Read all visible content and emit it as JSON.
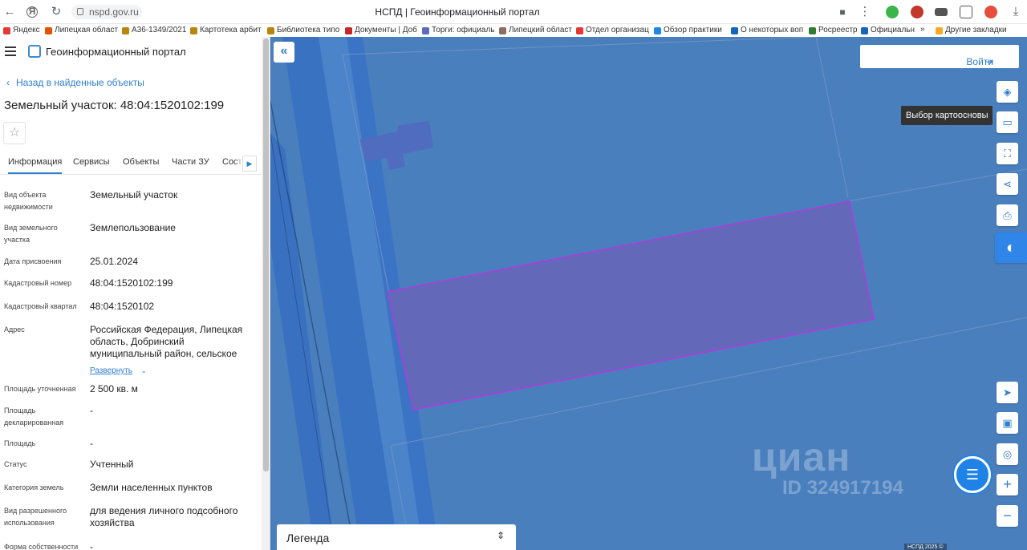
{
  "browser": {
    "url": "nspd.gov.ru",
    "tab_title": "НСПД | Геоинформационный портал",
    "bookmarks": [
      "Яндекс",
      "Липецкая област",
      "А36-1349/2021",
      "Картотека арбит",
      "Библиотека типо",
      "Документы | Доб",
      "Торги: официаль",
      "Липецкий област",
      "Отдел организац",
      "Обзор практики",
      "О некоторых воп",
      "Росреестр",
      "Официальн",
      "»",
      "Другие закладки"
    ],
    "colors": {
      "accent": "#2f7fd1",
      "map_bg": "#4a7fbe",
      "parcel_stroke": "#b03adf"
    }
  },
  "panel": {
    "portal_title": "Геоинформационный портал",
    "back_link": "Назад в найденные объекты",
    "object_title": "Земельный участок: 48:04:1520102:199",
    "tabs": [
      "Информация",
      "Сервисы",
      "Объекты",
      "Части ЗУ",
      "Соста"
    ],
    "rows": [
      {
        "label": "Вид объекта недвижимости",
        "value": "Земельный участок"
      },
      {
        "label": "Вид земельного участка",
        "value": "Землепользование"
      },
      {
        "label": "Дата присвоения",
        "value": "25.01.2024"
      },
      {
        "label": "Кадастровый номер",
        "value": "48:04:1520102:199"
      },
      {
        "label": "Кадастровый квартал",
        "value": "48:04:1520102"
      },
      {
        "label": "Адрес",
        "value": "Российская Федерация, Липецкая область, Добринский муниципальный район, сельское"
      },
      {
        "label": "Площадь уточненная",
        "value": "2 500 кв. м"
      },
      {
        "label": "Площадь декларированная",
        "value": "-"
      },
      {
        "label": "Площадь",
        "value": "-"
      },
      {
        "label": "Статус",
        "value": "Учтенный"
      },
      {
        "label": "Категория земель",
        "value": "Земли населенных пунктов"
      },
      {
        "label": "Вид разрешенного использования",
        "value": "для ведения личного подсобного хозяйства"
      },
      {
        "label": "Форма собственности",
        "value": "-"
      }
    ],
    "expand_label": "Развернуть"
  },
  "map": {
    "login": "Войти",
    "tooltip": "Выбор картоосновы",
    "legend": "Легенда",
    "watermark_1": "циан",
    "watermark_2": "ID 324917194",
    "attribution": "НСПД 2025 ©"
  }
}
